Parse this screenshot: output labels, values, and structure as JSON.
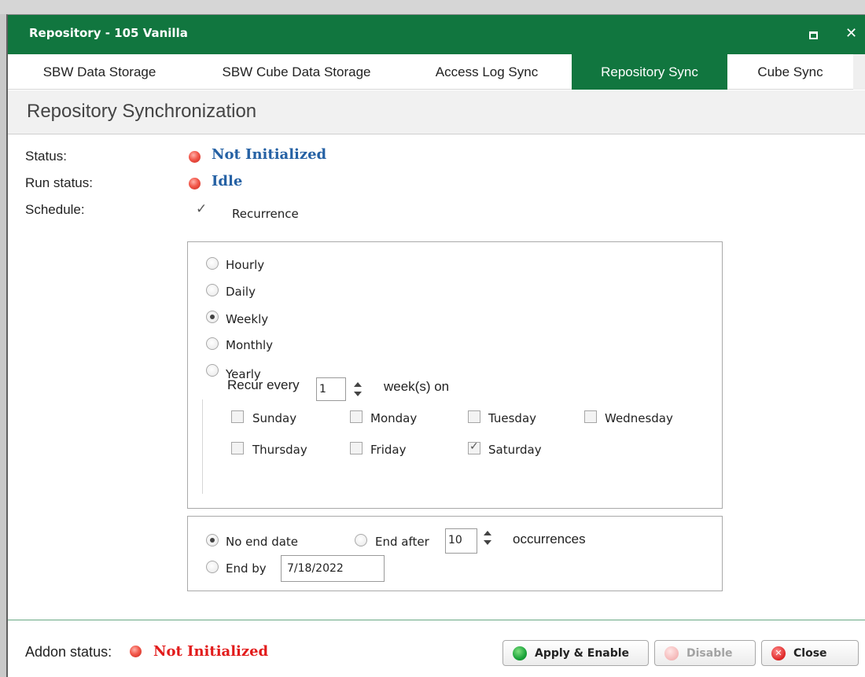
{
  "window": {
    "title": "Repository - 105 Vanilla"
  },
  "tabs": [
    {
      "label": "SBW Data Storage",
      "active": false
    },
    {
      "label": "SBW Cube Data Storage",
      "active": false
    },
    {
      "label": "Access Log Sync",
      "active": false
    },
    {
      "label": "Repository Sync",
      "active": true
    },
    {
      "label": "Cube Sync",
      "active": false
    }
  ],
  "section": {
    "title": "Repository Synchronization"
  },
  "status": {
    "status_label": "Status:",
    "status_value": "Not Initialized",
    "run_status_label": "Run status:",
    "run_status_value": "Idle",
    "schedule_label": "Schedule:",
    "recurrence_label": "Recurrence",
    "recurrence_checked": true
  },
  "recurrence": {
    "options": [
      {
        "label": "Hourly",
        "selected": false
      },
      {
        "label": "Daily",
        "selected": false
      },
      {
        "label": "Weekly",
        "selected": true
      },
      {
        "label": "Monthly",
        "selected": false
      },
      {
        "label": "Yearly",
        "selected": false
      }
    ],
    "recur_every_label": "Recur every",
    "recur_every_value": "1",
    "weeks_on_label": "week(s) on",
    "days": [
      {
        "label": "Sunday",
        "checked": false
      },
      {
        "label": "Monday",
        "checked": false
      },
      {
        "label": "Tuesday",
        "checked": false
      },
      {
        "label": "Wednesday",
        "checked": false
      },
      {
        "label": "Thursday",
        "checked": false
      },
      {
        "label": "Friday",
        "checked": false
      },
      {
        "label": "Saturday",
        "checked": true
      }
    ]
  },
  "end": {
    "no_end_label": "No end date",
    "no_end_selected": true,
    "end_after_label": "End after",
    "end_after_value": "10",
    "occurrences_label": "occurrences",
    "end_by_label": "End by",
    "end_by_value": "7/18/2022"
  },
  "footer": {
    "addon_label": "Addon status:",
    "addon_value": "Not Initialized",
    "apply_label": "Apply & Enable",
    "disable_label": "Disable",
    "close_label": "Close"
  },
  "colors": {
    "accent": "#11763f",
    "status_blue": "#2561a4",
    "status_red": "#e21b1b"
  },
  "icons": [
    "maximize-icon",
    "close-icon",
    "status-dot-icon",
    "check-icon",
    "spinner-icon"
  ]
}
